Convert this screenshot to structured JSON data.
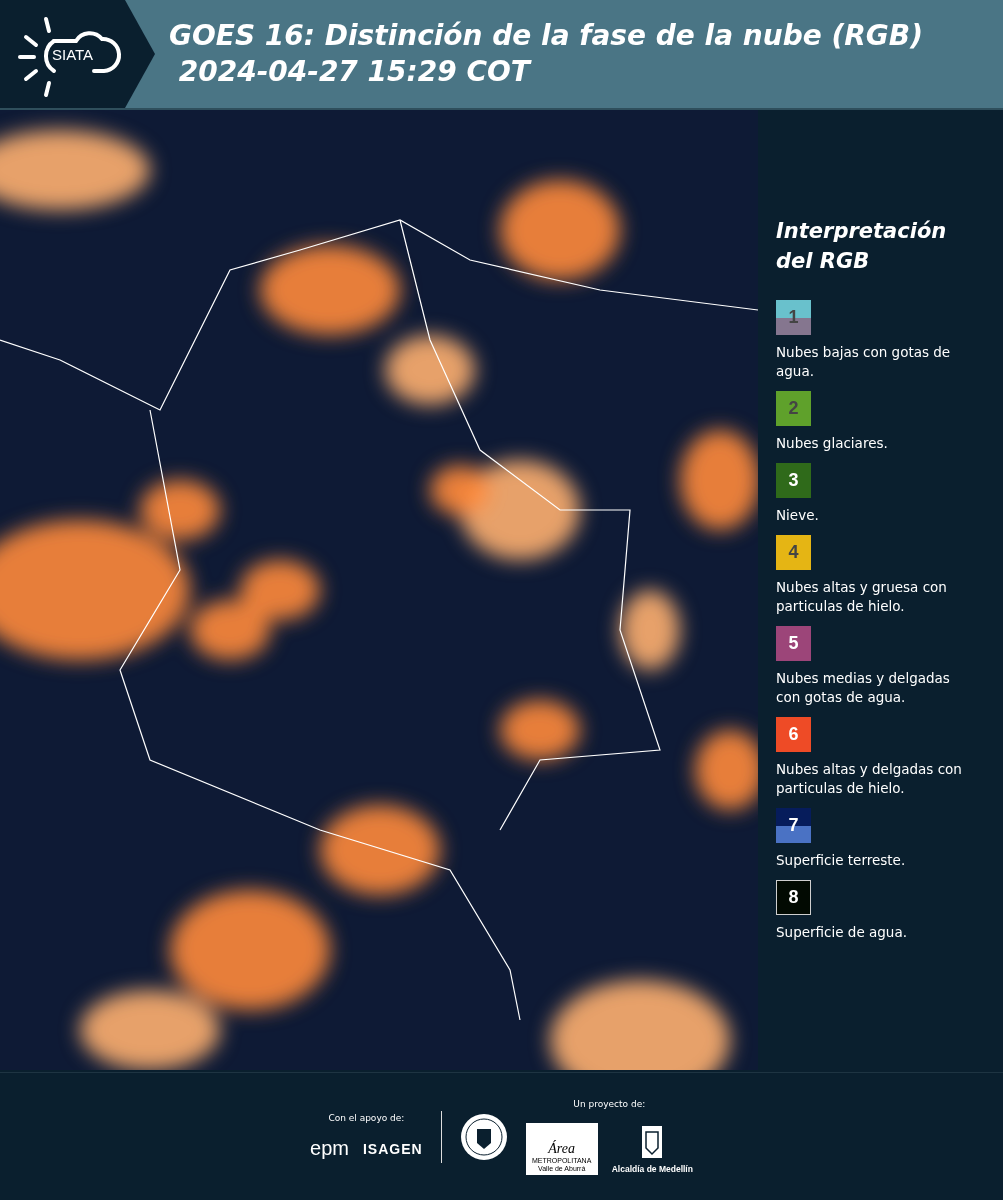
{
  "header": {
    "logo_text": "SIATA",
    "title": "GOES 16: Distinción de la fase de la nube (RGB)",
    "timestamp": "2024-04-27 15:29 COT"
  },
  "legend": {
    "title": "Interpretación del RGB",
    "items": [
      {
        "number": "1",
        "bands": [
          {
            "color": "#69c1cc"
          },
          {
            "color": "#85768f"
          }
        ],
        "label": "Nubes bajas con gotas de agua."
      },
      {
        "number": "2",
        "bands": [
          {
            "color": "#5fa12b"
          }
        ],
        "label": "Nubes glaciares."
      },
      {
        "number": "3",
        "bands": [
          {
            "color": "#2f6a1a"
          }
        ],
        "label": "Nieve."
      },
      {
        "number": "4",
        "bands": [
          {
            "color": "#e5b514"
          }
        ],
        "label": "Nubes altas y gruesa con particulas de hielo."
      },
      {
        "number": "5",
        "bands": [
          {
            "color": "#9c4579"
          }
        ],
        "label": "Nubes medias y delgadas con gotas de agua."
      },
      {
        "number": "6",
        "bands": [
          {
            "color": "#ee4b26"
          }
        ],
        "label": "Nubes altas y delgadas con particulas de hielo."
      },
      {
        "number": "7",
        "bands": [
          {
            "color": "#061c5b"
          },
          {
            "color": "#4a72c4"
          }
        ],
        "label": "Superficie terreste."
      },
      {
        "number": "8",
        "bands": [
          {
            "color": "#020a02"
          }
        ],
        "label": "Superficie de agua."
      }
    ]
  },
  "footer": {
    "support_label": "Con el apoyo de:",
    "support_logos": [
      "epm",
      "ISAGEN"
    ],
    "project_label": "Un proyecto de:",
    "area_logo": {
      "title": "Área",
      "line_1": "METROPOLITANA",
      "line_2": "Valle de Aburrá"
    },
    "city_label": "Alcaldía de Medellín"
  }
}
